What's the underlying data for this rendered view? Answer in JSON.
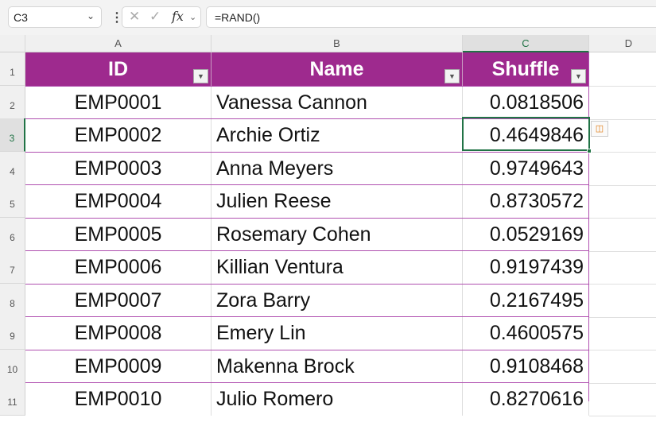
{
  "formula_bar": {
    "name_box": "C3",
    "formula": "=RAND()",
    "fx_label": "fx"
  },
  "columns": [
    "A",
    "B",
    "C",
    "D"
  ],
  "row_numbers": [
    "1",
    "2",
    "3",
    "4",
    "5",
    "6",
    "7",
    "8",
    "9",
    "10",
    "11"
  ],
  "table": {
    "headers": [
      "ID",
      "Name",
      "Shuffle"
    ],
    "rows": [
      [
        "EMP0001",
        "Vanessa Cannon",
        "0.0818506"
      ],
      [
        "EMP0002",
        "Archie Ortiz",
        "0.4649846"
      ],
      [
        "EMP0003",
        "Anna Meyers",
        "0.9749643"
      ],
      [
        "EMP0004",
        "Julien Reese",
        "0.8730572"
      ],
      [
        "EMP0005",
        "Rosemary Cohen",
        "0.0529169"
      ],
      [
        "EMP0006",
        "Killian Ventura",
        "0.9197439"
      ],
      [
        "EMP0007",
        "Zora Barry",
        "0.2167495"
      ],
      [
        "EMP0008",
        "Emery Lin",
        "0.4600575"
      ],
      [
        "EMP0009",
        "Makenna Brock",
        "0.9108468"
      ],
      [
        "EMP0010",
        "Julio Romero",
        "0.8270616"
      ]
    ]
  },
  "colors": {
    "header_bg": "#9e2a8e",
    "selection": "#217346"
  }
}
